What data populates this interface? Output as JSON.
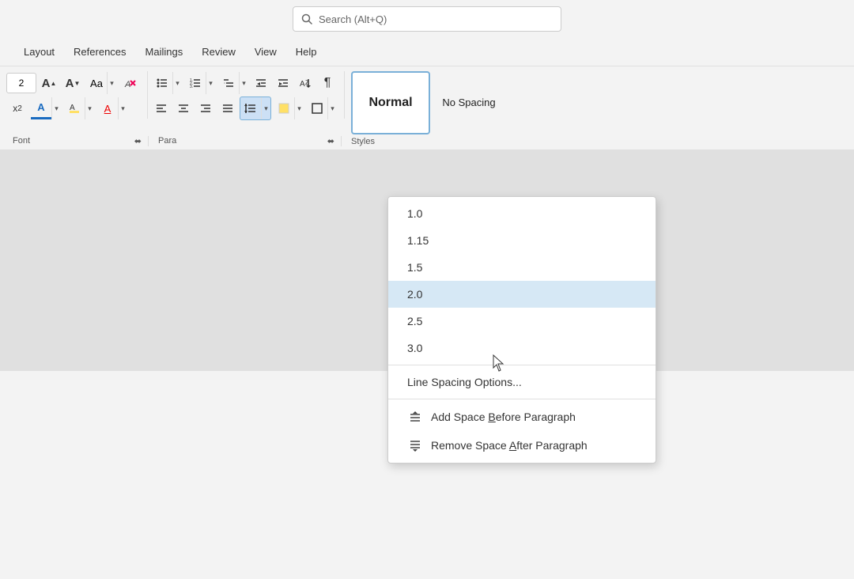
{
  "titlebar": {
    "search_placeholder": "Search (Alt+Q)"
  },
  "menubar": {
    "items": [
      "Layout",
      "References",
      "Mailings",
      "Review",
      "View",
      "Help"
    ]
  },
  "ribbon": {
    "font_size": "2",
    "section_font": "Font",
    "section_paragraph": "Para",
    "section_styles": "Styles",
    "styles": {
      "normal_label": "Normal",
      "nospacing_label": "No Spacing"
    }
  },
  "dropdown": {
    "spacing_options": [
      {
        "value": "1.0",
        "highlighted": false
      },
      {
        "value": "1.15",
        "highlighted": false
      },
      {
        "value": "1.5",
        "highlighted": false
      },
      {
        "value": "2.0",
        "highlighted": true
      },
      {
        "value": "2.5",
        "highlighted": false
      },
      {
        "value": "3.0",
        "highlighted": false
      }
    ],
    "line_spacing_options_label": "Line Spacing Options...",
    "add_space_before": "Add Space Before Paragraph",
    "remove_space_after": "Remove Space After Paragraph",
    "add_space_shortcut": "B",
    "remove_space_shortcut": "A"
  }
}
